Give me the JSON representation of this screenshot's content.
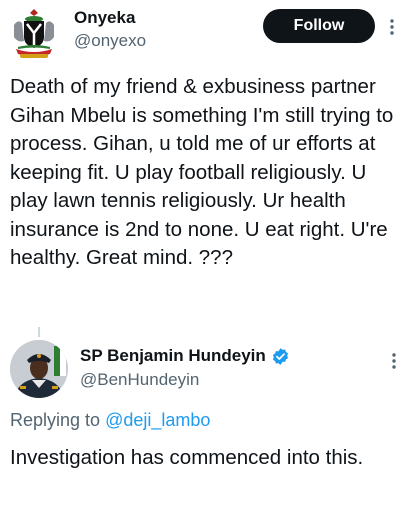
{
  "tweet": {
    "author": {
      "name": "Onyeka",
      "handle": "@onyexo"
    },
    "follow_label": "Follow",
    "text": "Death of my friend & exbusiness partner Gihan Mbelu is something I'm still trying to process. Gihan, u told me of ur efforts at keeping fit. U play football religiously. U play lawn tennis religiously. Ur health insurance is 2nd to none. U eat right. U're healthy. Great mind. ???"
  },
  "reply": {
    "author": {
      "name": "SP Benjamin Hundeyin",
      "handle": "@BenHundeyin",
      "verified": true
    },
    "replying_prefix": "Replying to ",
    "replying_to": "@deji_lambo",
    "text": "Investigation has commenced into this."
  },
  "icons": {
    "avatar_1": "coat-of-arms-avatar",
    "avatar_2": "uniformed-officer-avatar",
    "more": "more-vertical-icon",
    "verified": "verified-badge-icon"
  },
  "colors": {
    "text_primary": "#0f1419",
    "text_secondary": "#536471",
    "link": "#1d9bf0",
    "follow_button_bg": "#0f1419",
    "verified": "#1d9bf0"
  }
}
